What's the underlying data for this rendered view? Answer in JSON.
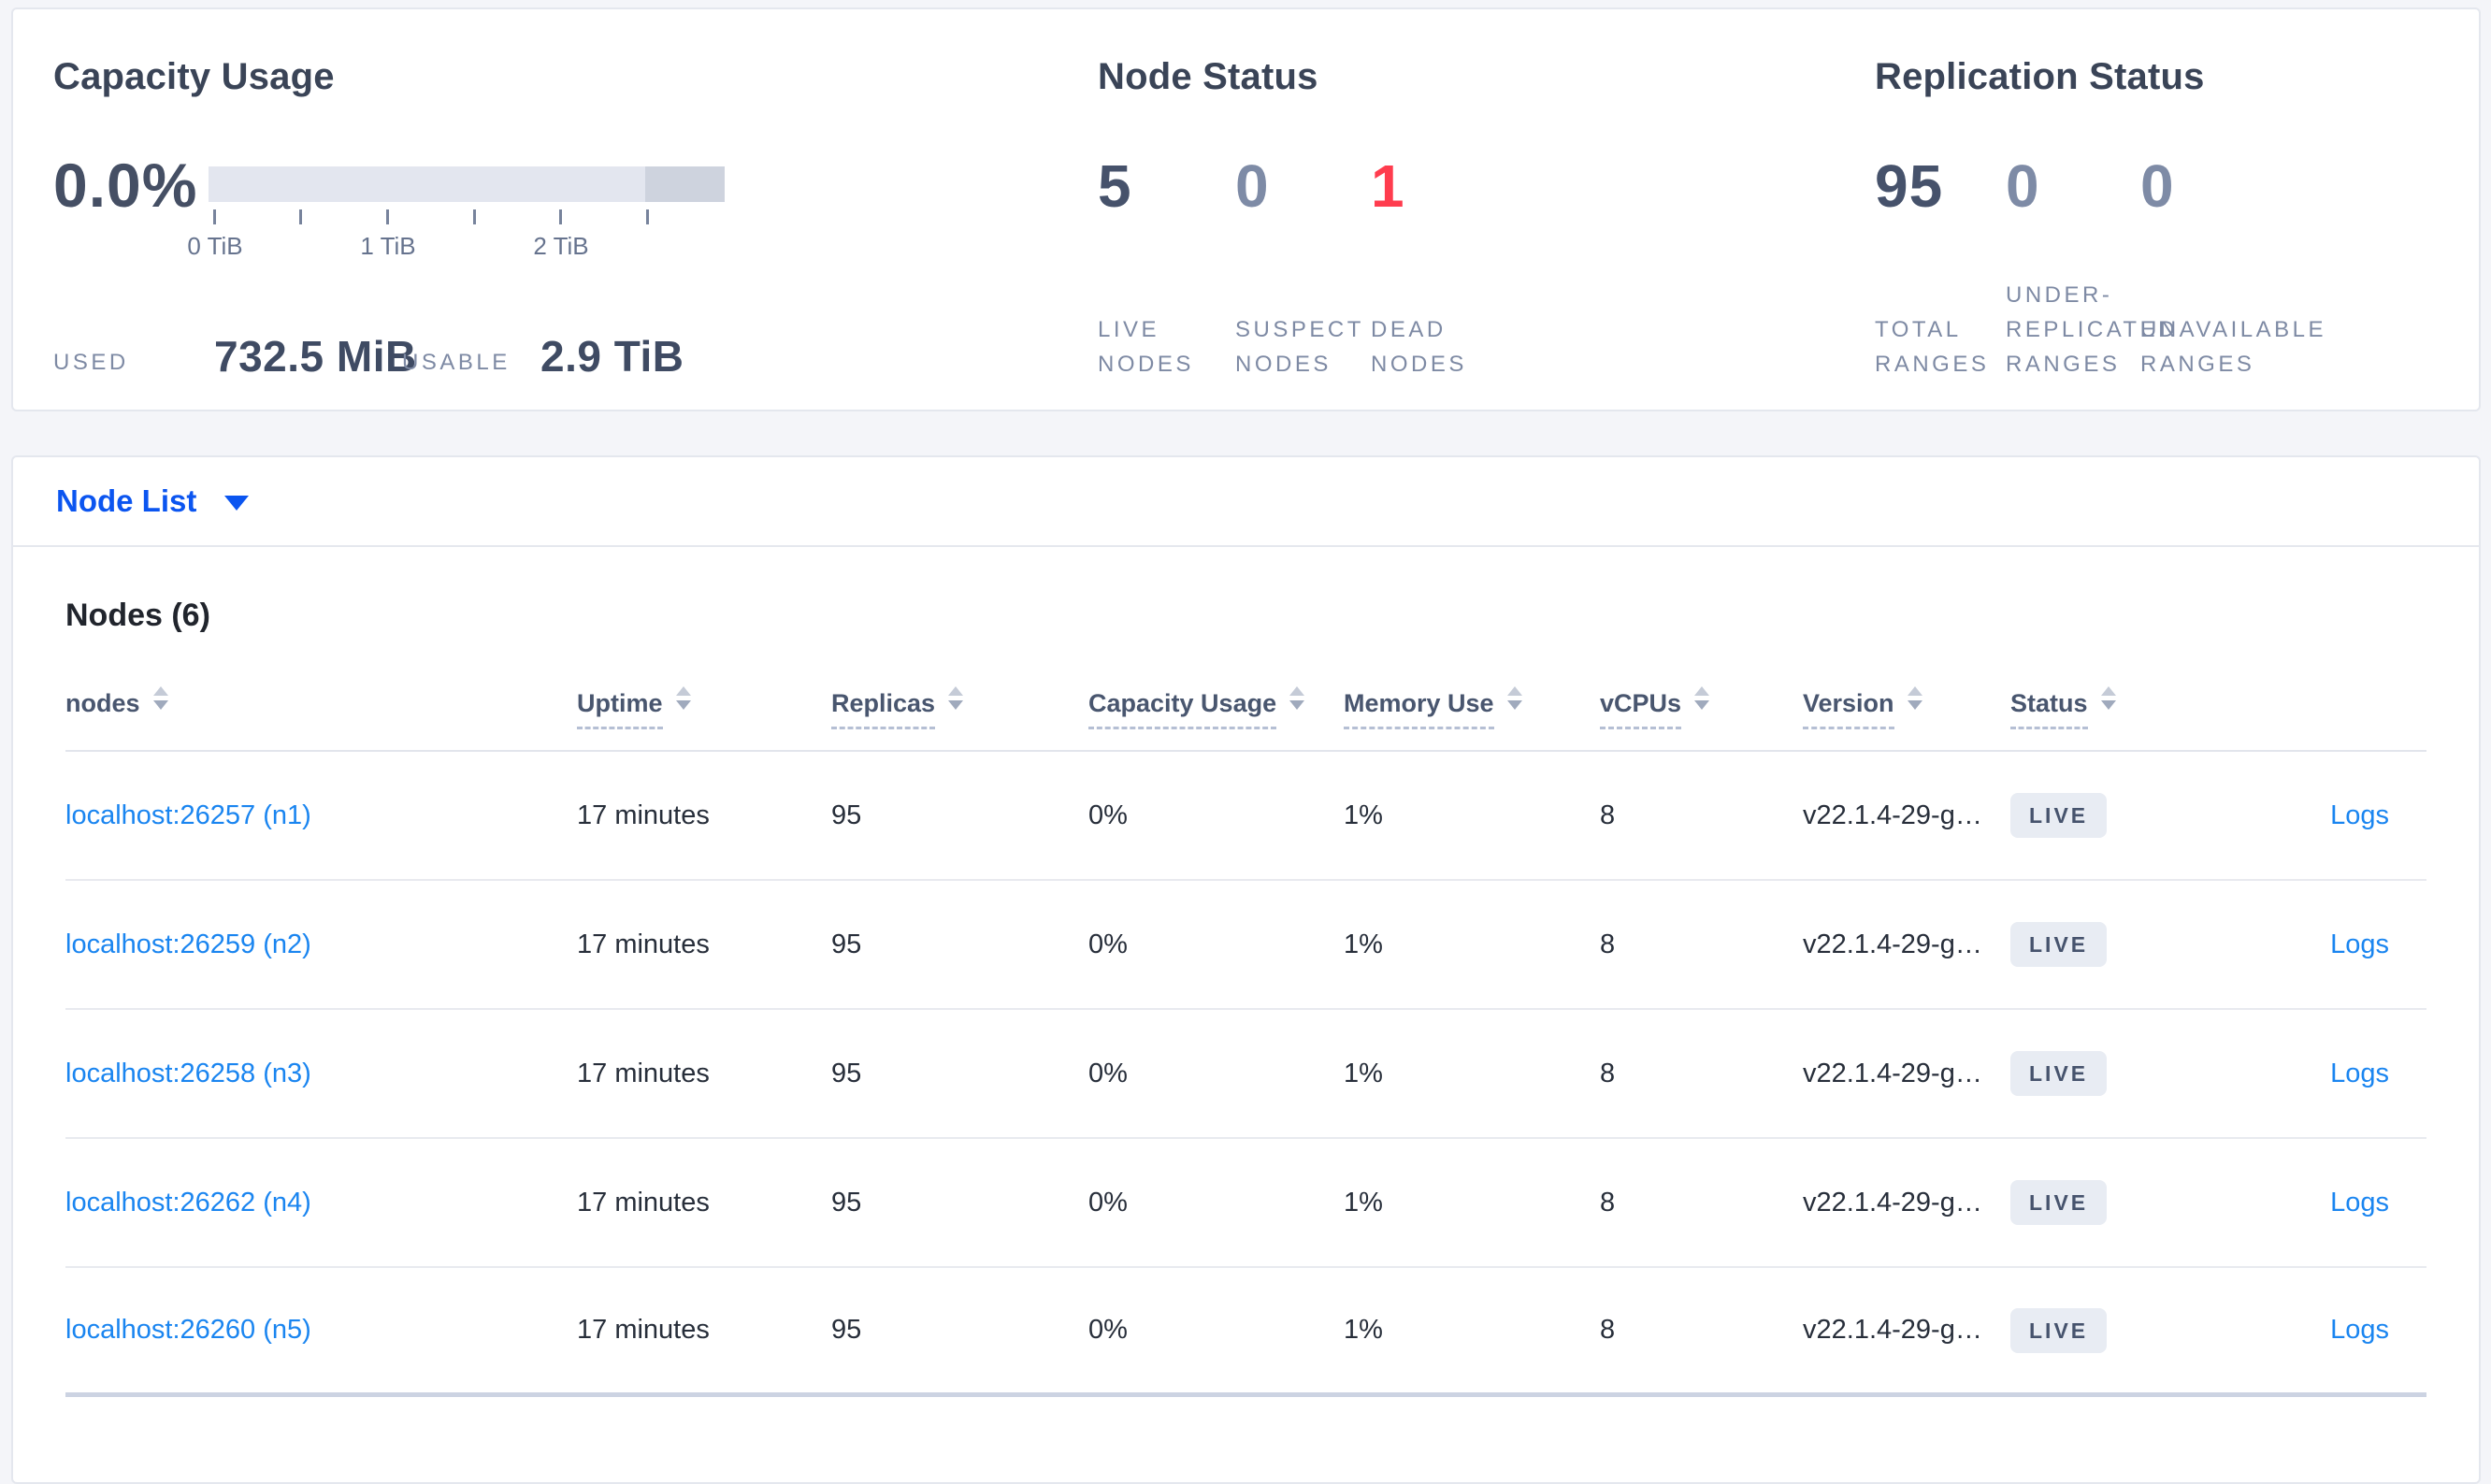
{
  "colors": {
    "page_bg": "#f4f5f9",
    "link_blue": "#1a85f0",
    "selector_blue": "#0b55f0",
    "dead_red": "#ff3c4e",
    "badge_bg": "#e8ecf3",
    "bar_light": "#e3e6ef",
    "bar_dark": "#ced3de"
  },
  "capacity": {
    "title": "Capacity Usage",
    "percent": "0.0%",
    "tick_labels": [
      "0 TiB",
      "1 TiB",
      "2 TiB"
    ],
    "used_label": "USED",
    "used_value": "732.5 MiB",
    "usable_label": "USABLE",
    "usable_value": "2.9 TiB"
  },
  "node_status": {
    "title": "Node Status",
    "stats": [
      {
        "value": "5",
        "label": "LIVE\nNODES",
        "tone": "dark"
      },
      {
        "value": "0",
        "label": "SUSPECT\nNODES",
        "tone": "light"
      },
      {
        "value": "1",
        "label": "DEAD\nNODES",
        "tone": "red"
      }
    ]
  },
  "replication_status": {
    "title": "Replication Status",
    "stats": [
      {
        "value": "95",
        "label": "TOTAL\nRANGES",
        "tone": "dark"
      },
      {
        "value": "0",
        "label": "UNDER-\nREPLICATED\nRANGES",
        "tone": "light"
      },
      {
        "value": "0",
        "label": "UNAVAILABLE\nRANGES",
        "tone": "light"
      }
    ]
  },
  "view_selector": {
    "label": "Node List"
  },
  "nodes_table": {
    "title": "Nodes (6)",
    "columns": [
      {
        "label": "nodes"
      },
      {
        "label": "Uptime"
      },
      {
        "label": "Replicas"
      },
      {
        "label": "Capacity Usage"
      },
      {
        "label": "Memory Use"
      },
      {
        "label": "vCPUs"
      },
      {
        "label": "Version"
      },
      {
        "label": "Status"
      }
    ],
    "rows": [
      {
        "address": "localhost:26257 (n1)",
        "uptime": "17 minutes",
        "replicas": "95",
        "capacity": "0%",
        "memory": "1%",
        "vcpus": "8",
        "version": "v22.1.4-29-g…",
        "status": "LIVE",
        "logs": "Logs"
      },
      {
        "address": "localhost:26259 (n2)",
        "uptime": "17 minutes",
        "replicas": "95",
        "capacity": "0%",
        "memory": "1%",
        "vcpus": "8",
        "version": "v22.1.4-29-g…",
        "status": "LIVE",
        "logs": "Logs"
      },
      {
        "address": "localhost:26258 (n3)",
        "uptime": "17 minutes",
        "replicas": "95",
        "capacity": "0%",
        "memory": "1%",
        "vcpus": "8",
        "version": "v22.1.4-29-g…",
        "status": "LIVE",
        "logs": "Logs"
      },
      {
        "address": "localhost:26262 (n4)",
        "uptime": "17 minutes",
        "replicas": "95",
        "capacity": "0%",
        "memory": "1%",
        "vcpus": "8",
        "version": "v22.1.4-29-g…",
        "status": "LIVE",
        "logs": "Logs"
      },
      {
        "address": "localhost:26260 (n5)",
        "uptime": "17 minutes",
        "replicas": "95",
        "capacity": "0%",
        "memory": "1%",
        "vcpus": "8",
        "version": "v22.1.4-29-g…",
        "status": "LIVE",
        "logs": "Logs"
      }
    ]
  }
}
